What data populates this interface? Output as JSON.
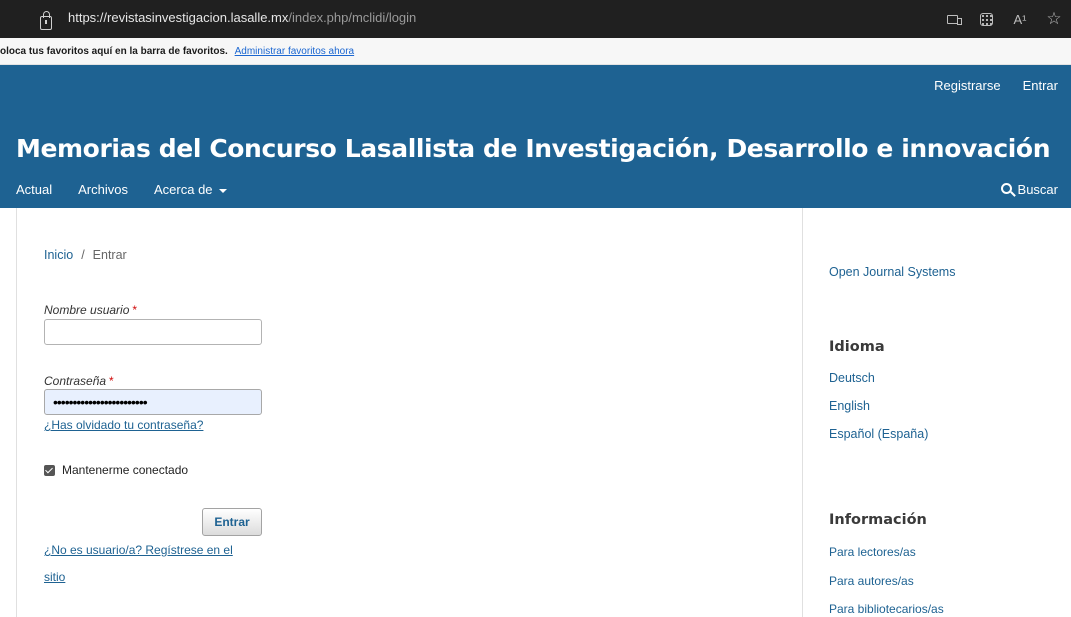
{
  "browser": {
    "url_host": "https://revistasinvestigacion.lasalle.mx",
    "url_path": "/index.php/mclidi/login",
    "toolbar_icons": [
      "reader-view-icon",
      "apps-icon",
      "read-aloud-icon",
      "favorites-icon"
    ],
    "read_aloud_label": "A¹",
    "favorites_glyph": "☆"
  },
  "favorites_bar": {
    "message": "oloca tus favoritos aquí en la barra de favoritos.",
    "manage_link": "Administrar favoritos ahora"
  },
  "header": {
    "register": "Registrarse",
    "login": "Entrar",
    "site_title": "Memorias del Concurso Lasallista de Investigación, Desarrollo e innovación",
    "nav": [
      "Actual",
      "Archivos",
      "Acerca de"
    ],
    "search": "Buscar"
  },
  "breadcrumb": {
    "home": "Inicio",
    "separator": "/",
    "current": "Entrar"
  },
  "form": {
    "username_label": "Nombre usuario",
    "username_value": "",
    "password_label": "Contraseña",
    "password_value": "••••••••••••••••••••••••",
    "required_mark": "*",
    "forgot_link": "¿Has olvidado tu contraseña?",
    "remember_label": "Mantenerme conectado",
    "remember_checked": true,
    "submit": "Entrar",
    "register_line1": "¿No es usuario/a? Regístrese en el",
    "register_line2": "sitio"
  },
  "sidebar": {
    "ojs": "Open Journal Systems",
    "language_title": "Idioma",
    "languages": [
      "Deutsch",
      "English",
      "Español (España)"
    ],
    "info_title": "Información",
    "info_links": [
      "Para lectores/as",
      "Para autores/as",
      "Para bibliotecarios/as"
    ]
  },
  "colors": {
    "header_bg": "#1e6292",
    "link": "#1e6292",
    "required": "#d00a0a",
    "browser_bar": "#202020",
    "autofill_bg": "#e8f0fe"
  }
}
